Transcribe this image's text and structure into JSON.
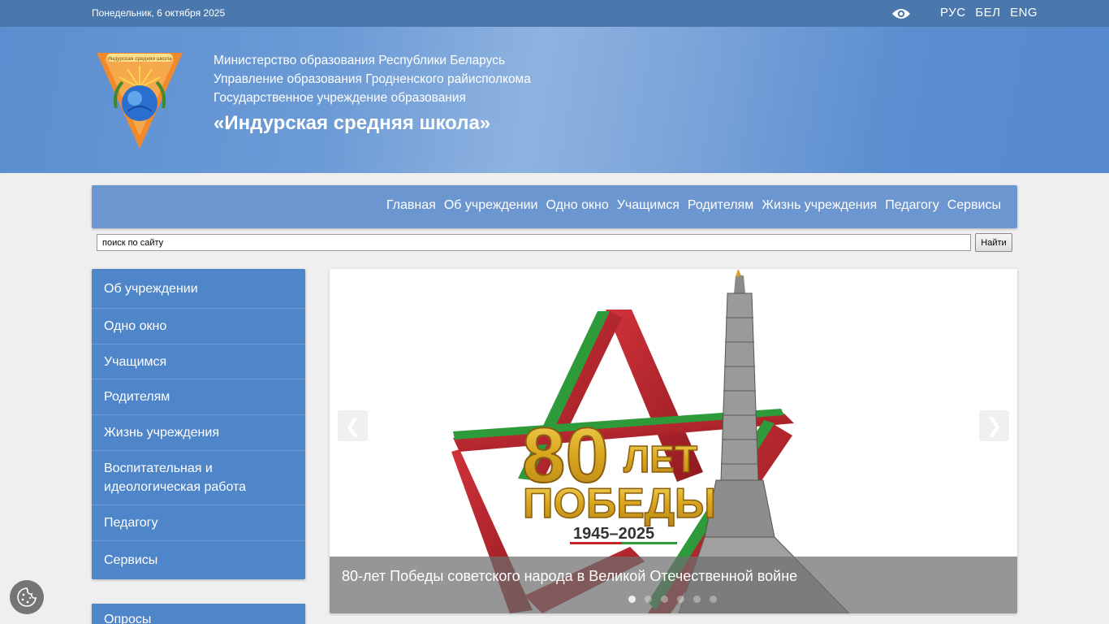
{
  "topbar": {
    "date": "Понедельник, 6 октября 2025",
    "accessibility_icon": "eye-icon",
    "languages": [
      "РУС",
      "БЕЛ",
      "ENG"
    ]
  },
  "header": {
    "logo_text": "Индурская средняя школа",
    "lines": [
      "Министерство образования Республики Беларусь",
      "Управление образования Гродненского райисполкома",
      "Государственное учреждение образования"
    ],
    "school_name": "«Индурская средняя школа»"
  },
  "nav": {
    "items": [
      "Главная",
      "Об учреждении",
      "Одно окно",
      "Учащимся",
      "Родителям",
      "Жизнь учреждения",
      "Педагогу",
      "Сервисы"
    ]
  },
  "search": {
    "value": "поиск по сайту",
    "button_label": "Найти"
  },
  "sidemenu": {
    "items": [
      "Об учреждении",
      "Одно окно",
      "Учащимся",
      "Родителям",
      "Жизнь учреждения",
      "Воспитательная и идеологическая работа",
      "Педагогу",
      "Сервисы"
    ]
  },
  "polls": {
    "title": "Опросы"
  },
  "slider": {
    "banner_big": "80",
    "banner_let": "ЛЕТ",
    "banner_pobedy": "ПОБЕДЫ",
    "banner_years": "1945–2025",
    "caption": "80-лет Победы советского народа в Великой Отечественной войне",
    "prev_icon": "chevron-left-icon",
    "next_icon": "chevron-right-icon",
    "slide_count": 6,
    "active_slide": 1
  },
  "colors": {
    "topbar": "#4a78ad",
    "header": "#5b8ed0",
    "nav": "#6b96cf",
    "sidemenu": "#4f85c9",
    "star_red": "#c0262b",
    "star_green": "#2e9a3a",
    "gold": "#e2b526"
  },
  "cookie": {
    "icon": "cookie-icon"
  }
}
